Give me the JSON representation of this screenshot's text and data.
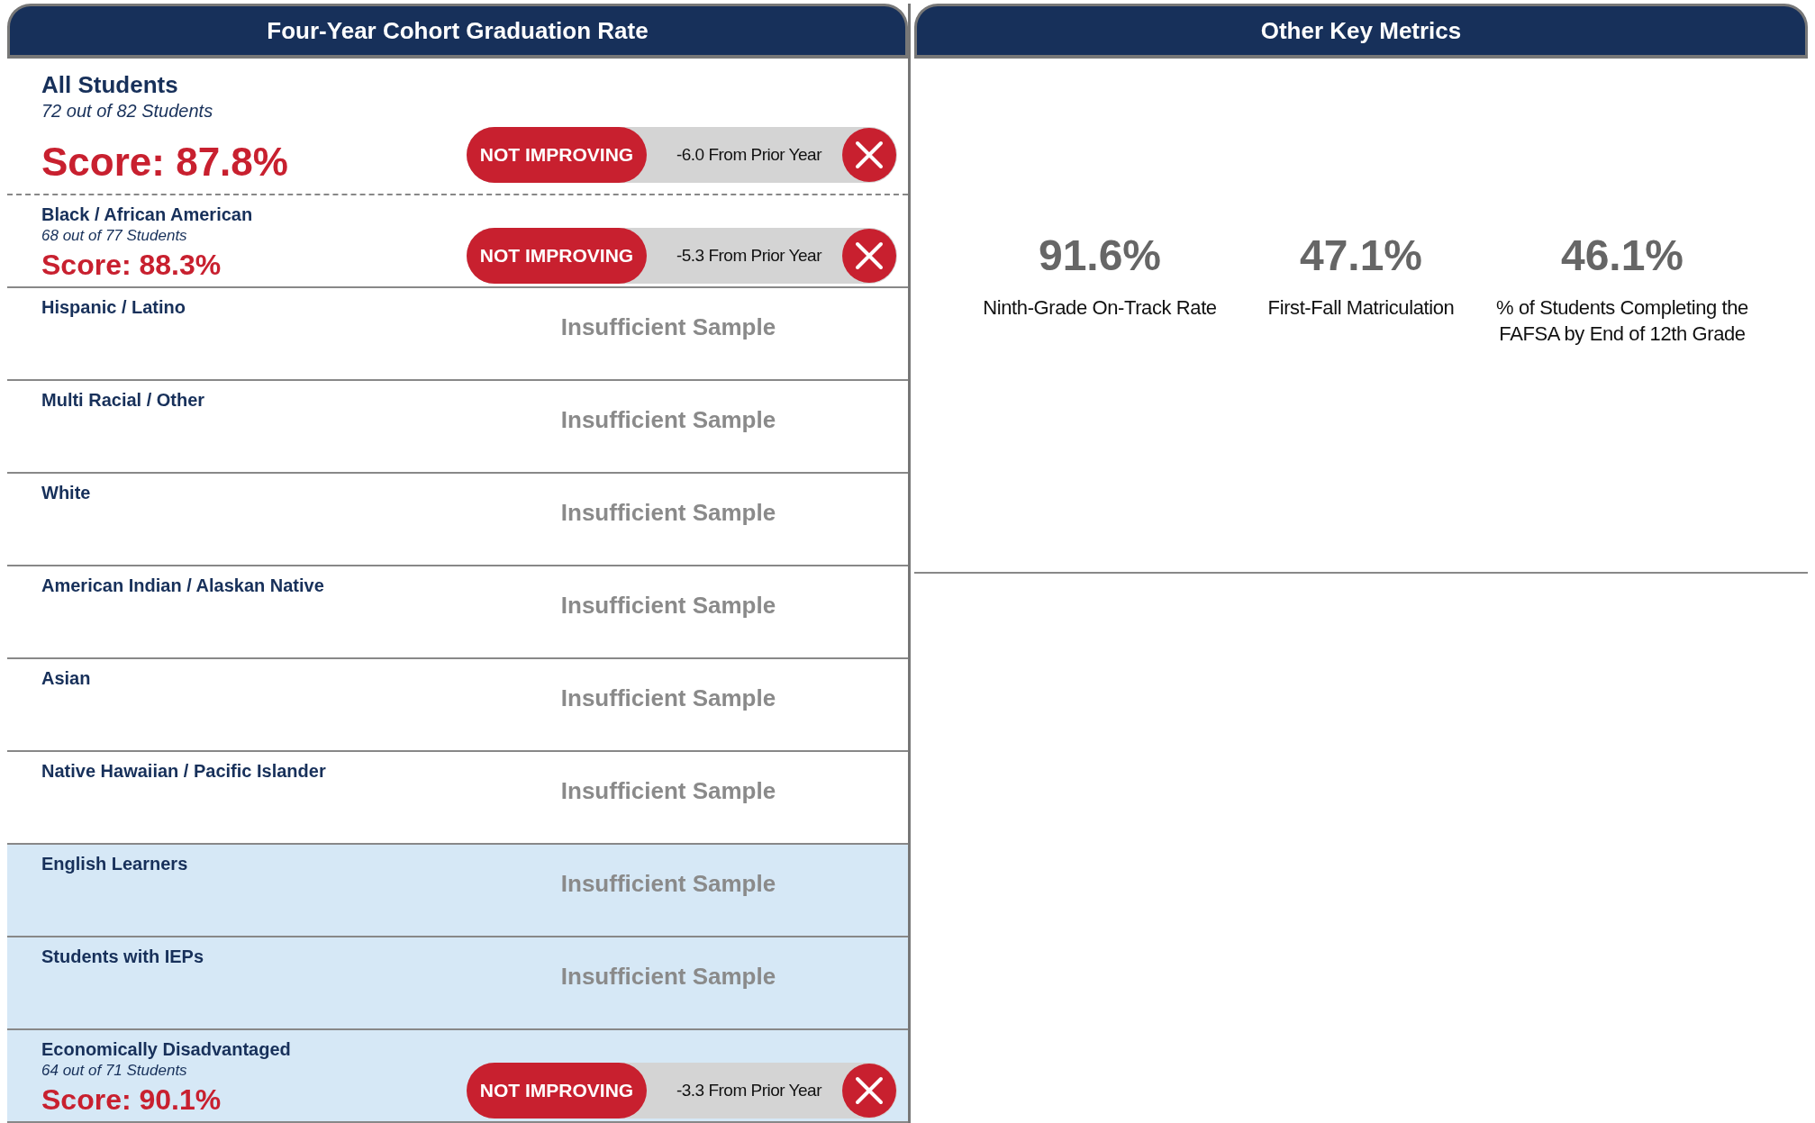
{
  "graduation_panel": {
    "title": "Four-Year Cohort Graduation Rate",
    "groups": [
      {
        "kind": "overall",
        "name": "All Students",
        "count": "72 out of 82 Students",
        "score": "Score: 87.8%",
        "status": "NOT IMPROVING",
        "change": "-6.0 From Prior Year",
        "shaded": false
      },
      {
        "kind": "scored",
        "name": "Black / African American",
        "count": "68 out of 77 Students",
        "score": "Score: 88.3%",
        "status": "NOT IMPROVING",
        "change": "-5.3 From Prior Year",
        "shaded": false
      },
      {
        "kind": "insufficient",
        "name": "Hispanic / Latino",
        "note": "Insufficient Sample",
        "shaded": false
      },
      {
        "kind": "insufficient",
        "name": "Multi Racial / Other",
        "note": "Insufficient Sample",
        "shaded": false
      },
      {
        "kind": "insufficient",
        "name": "White",
        "note": "Insufficient Sample",
        "shaded": false
      },
      {
        "kind": "insufficient",
        "name": "American Indian / Alaskan Native",
        "note": "Insufficient Sample",
        "shaded": false
      },
      {
        "kind": "insufficient",
        "name": "Asian",
        "note": "Insufficient Sample",
        "shaded": false
      },
      {
        "kind": "insufficient",
        "name": "Native Hawaiian / Pacific Islander",
        "note": "Insufficient Sample",
        "shaded": false
      },
      {
        "kind": "insufficient",
        "name": "English Learners",
        "note": "Insufficient Sample",
        "shaded": true
      },
      {
        "kind": "insufficient",
        "name": "Students with IEPs",
        "note": "Insufficient Sample",
        "shaded": true
      },
      {
        "kind": "scored",
        "name": "Economically Disadvantaged",
        "count": "64 out of 71 Students",
        "score": "Score: 90.1%",
        "status": "NOT IMPROVING",
        "change": "-3.3 From Prior Year",
        "shaded": true
      }
    ]
  },
  "metrics_panel": {
    "title": "Other Key Metrics",
    "metrics": [
      {
        "value": "91.6%",
        "label": "Ninth-Grade On-Track Rate"
      },
      {
        "value": "47.1%",
        "label": "First-Fall Matriculation"
      },
      {
        "value": "46.1%",
        "label": "% of Students Completing the FAFSA by End of 12th Grade"
      }
    ]
  }
}
